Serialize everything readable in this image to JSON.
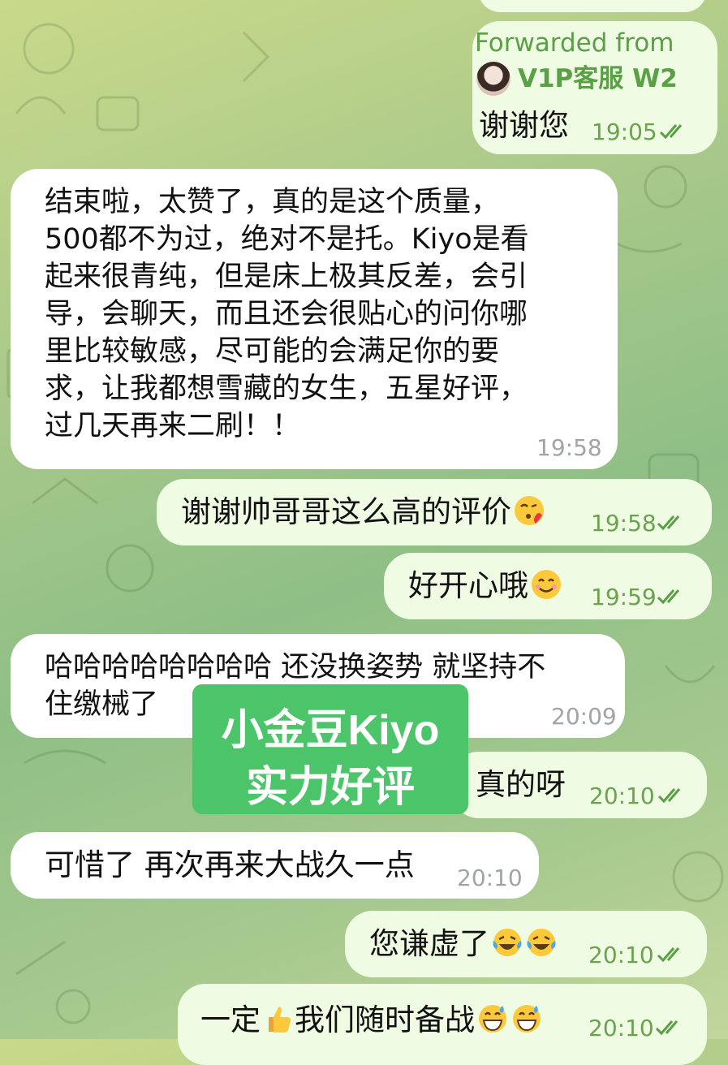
{
  "messages": [
    {
      "forward_label": "Forwarded from",
      "forward_sender": "V1P客服 W2",
      "text": "谢谢您",
      "time": "19:05"
    },
    {
      "lines": [
        "结束啦，太赞了，真的是这个质量，",
        "500都不为过，绝对不是托。Kiyo是看",
        "起来很青纯，但是床上极其反差，会引",
        "导，会聊天，而且还会很贴心的问你哪",
        "里比较敏感，尽可能的会满足你的要",
        "求，让我都想雪藏的女生，五星好评，",
        "过几天再来二刷！！"
      ],
      "time": "19:58"
    },
    {
      "text": "谢谢帅哥哥这么高的评价",
      "emoji": "face-blowing-kiss",
      "time": "19:58"
    },
    {
      "text": "好开心哦",
      "emoji": "smiling-face",
      "time": "19:59"
    },
    {
      "lines": [
        "哈哈哈哈哈哈哈哈 还没换姿势 就坚持不",
        "住缴械了"
      ],
      "time": "20:09"
    },
    {
      "text": "真的呀",
      "time": "20:10"
    },
    {
      "text": "可惜了 再次再来大战久一点",
      "time": "20:10"
    },
    {
      "text": "您谦虚了",
      "emoji": "tears-of-joy",
      "time": "20:10"
    },
    {
      "text_a": "一定",
      "text_b": "我们随时备战",
      "emoji": "thumbs-up / grinning-sweat",
      "time": "20:10"
    }
  ],
  "overlay": {
    "line1": "小金豆Kiyo",
    "line2": "实力好评"
  },
  "colors": {
    "outgoing_bubble": "#f0fbe3",
    "incoming_bubble": "#ffffff",
    "accent": "#5aa046",
    "overlay": "#4cc56a"
  }
}
